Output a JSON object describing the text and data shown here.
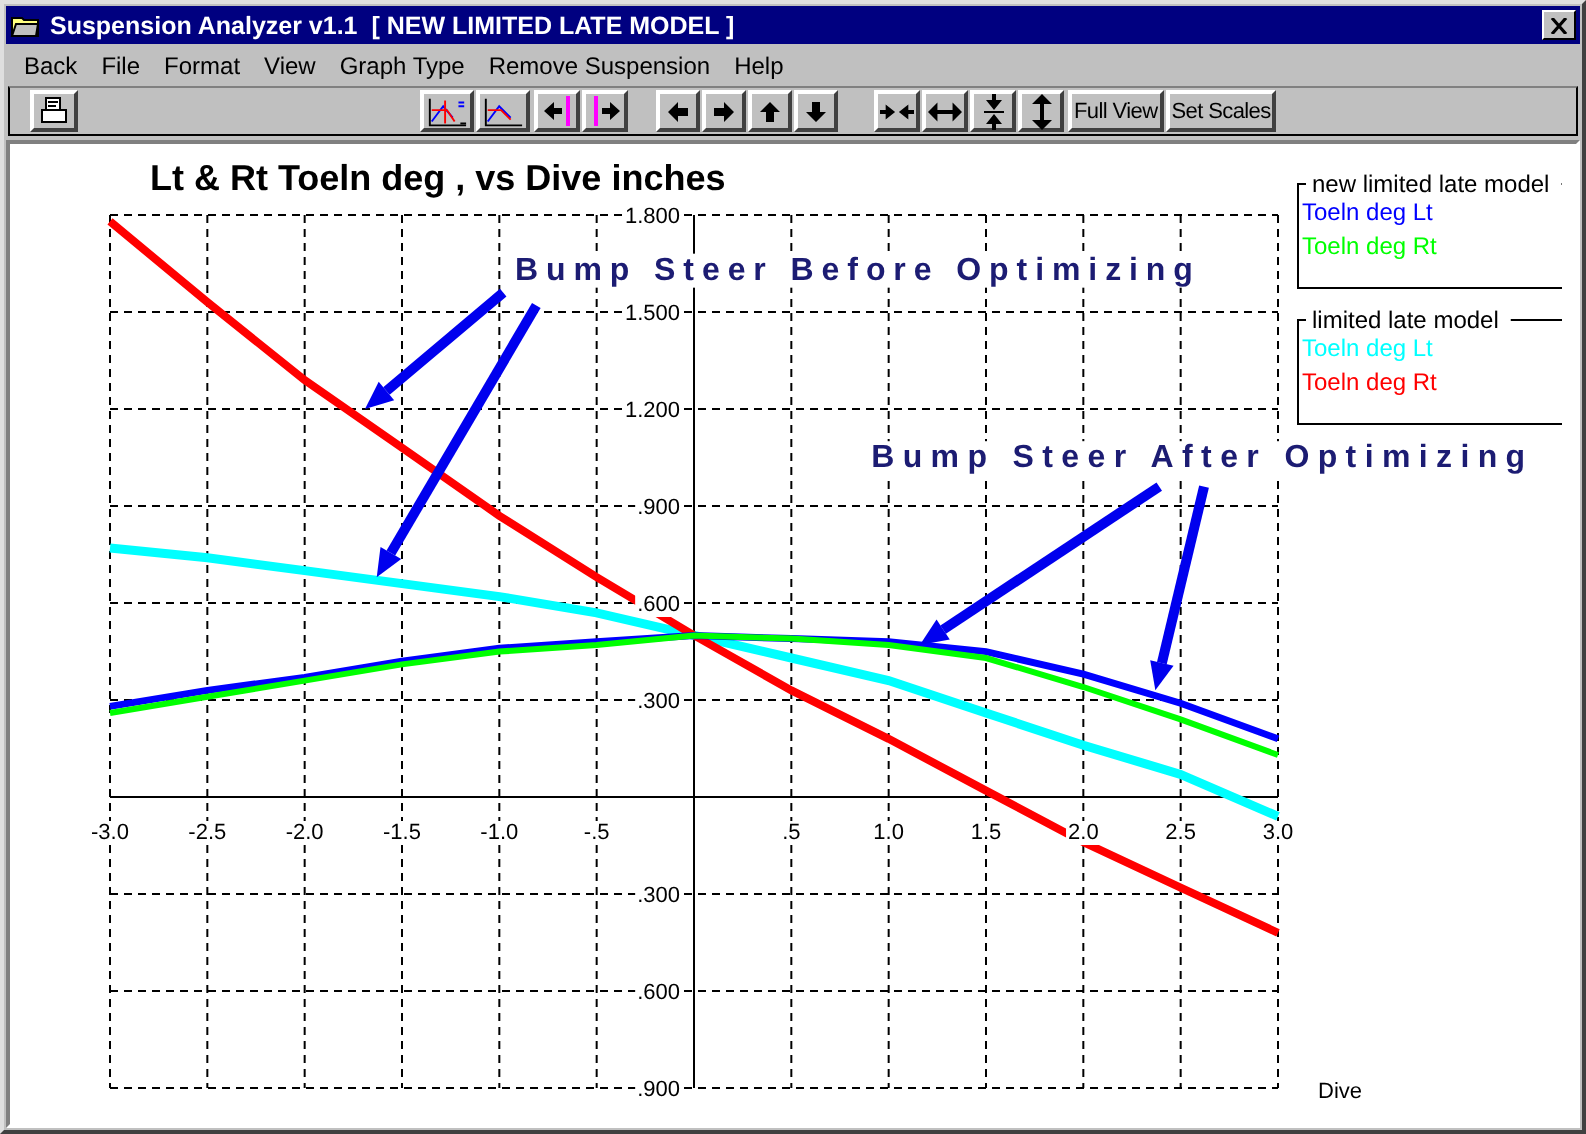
{
  "window": {
    "title": "Suspension Analyzer v1.1  [ NEW LIMITED LATE MODEL ]"
  },
  "menu": [
    "Back",
    "File",
    "Format",
    "View",
    "Graph Type",
    "Remove Suspension",
    "Help"
  ],
  "toolbar_text_buttons": [
    "Full View",
    "Set Scales"
  ],
  "chart_data": {
    "type": "line",
    "title": "Lt & Rt Toeln deg , vs Dive inches",
    "xlabel": "Dive",
    "grid": true,
    "x": [
      -3,
      -2.5,
      -2,
      -1.5,
      -1,
      -0.5,
      0,
      0.5,
      1,
      1.5,
      2,
      2.5,
      3
    ],
    "xlim": [
      -3,
      3
    ],
    "ylim": [
      -0.9,
      1.8
    ],
    "xticks": [
      {
        "value": -3,
        "label": "-3.0"
      },
      {
        "value": -2.5,
        "label": "-2.5"
      },
      {
        "value": -2,
        "label": "-2.0"
      },
      {
        "value": -1.5,
        "label": "-1.5"
      },
      {
        "value": -1,
        "label": "-1.0"
      },
      {
        "value": -0.5,
        "label": "-.5"
      },
      {
        "value": 0.5,
        "label": ".5"
      },
      {
        "value": 1,
        "label": "1.0"
      },
      {
        "value": 1.5,
        "label": "1.5"
      },
      {
        "value": 2,
        "label": "2.0"
      },
      {
        "value": 2.5,
        "label": "2.5"
      },
      {
        "value": 3,
        "label": "3.0"
      }
    ],
    "yticks": [
      {
        "value": 1.8,
        "label": "1.800"
      },
      {
        "value": 1.5,
        "label": "1.500"
      },
      {
        "value": 1.2,
        "label": "1.200"
      },
      {
        "value": 0.9,
        "label": ".900"
      },
      {
        "value": 0.6,
        "label": ".600"
      },
      {
        "value": 0.3,
        "label": ".300"
      },
      {
        "value": -0.3,
        "label": ".300"
      },
      {
        "value": -0.6,
        "label": ".600"
      },
      {
        "value": -0.9,
        "label": ".900"
      }
    ],
    "series": [
      {
        "color": "#0000ff",
        "values": [
          0.28,
          0.33,
          0.37,
          0.42,
          0.46,
          0.48,
          0.5,
          0.49,
          0.48,
          0.45,
          0.38,
          0.29,
          0.18
        ]
      },
      {
        "color": "#00ff00",
        "values": [
          0.26,
          0.31,
          0.36,
          0.41,
          0.45,
          0.47,
          0.5,
          0.49,
          0.47,
          0.43,
          0.34,
          0.24,
          0.13
        ]
      },
      {
        "color": "#00ffff",
        "values": [
          0.77,
          0.74,
          0.7,
          0.66,
          0.62,
          0.57,
          0.5,
          0.43,
          0.36,
          0.26,
          0.16,
          0.07,
          -0.06
        ]
      },
      {
        "color": "#ff0000",
        "values": [
          1.78,
          1.53,
          1.29,
          1.08,
          0.87,
          0.68,
          0.5,
          0.33,
          0.18,
          0.02,
          -0.14,
          -0.28,
          -0.42
        ]
      }
    ],
    "annotations": [
      "Bump Steer Before Optimizing",
      "Bump Steer After Optimizing"
    ]
  },
  "legend": [
    {
      "title": "new limited late model",
      "entries": [
        {
          "label": "Toeln deg Lt",
          "color": "#0000ff"
        },
        {
          "label": "Toeln deg Rt",
          "color": "#00ff00"
        }
      ]
    },
    {
      "title": "limited late model",
      "entries": [
        {
          "label": "Toeln deg Lt",
          "color": "#00ffff"
        },
        {
          "label": "Toeln deg Rt",
          "color": "#ff0000"
        }
      ]
    }
  ]
}
